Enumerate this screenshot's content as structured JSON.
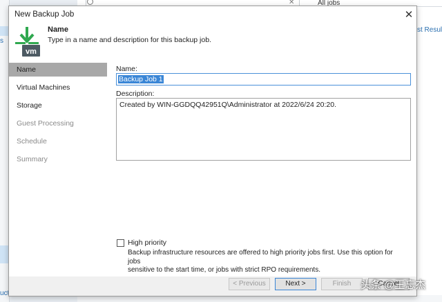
{
  "background": {
    "search_clear": "✕",
    "all_jobs": "All jobs",
    "last_result": "st Result",
    "left_frag_top": "s",
    "left_frag_bottom": "ucti"
  },
  "dialog": {
    "title": "New Backup Job",
    "close": "✕"
  },
  "header": {
    "icon": "vm-icon",
    "title": "Name",
    "description": "Type in a name and description for this backup job."
  },
  "sidebar": {
    "items": [
      {
        "label": "Name",
        "state": "active"
      },
      {
        "label": "Virtual Machines",
        "state": "enabled"
      },
      {
        "label": "Storage",
        "state": "enabled"
      },
      {
        "label": "Guest Processing",
        "state": "disabled"
      },
      {
        "label": "Schedule",
        "state": "disabled"
      },
      {
        "label": "Summary",
        "state": "disabled"
      }
    ]
  },
  "form": {
    "name_label": "Name:",
    "name_value": "Backup Job 1",
    "description_label": "Description:",
    "description_value": "Created by WIN-GGDQQ42951Q\\Administrator at 2022/6/24 20:20.",
    "high_priority_label": "High priority",
    "high_priority_checked": false,
    "high_priority_desc_line1": "Backup infrastructure resources are offered to high priority jobs first. Use this option for jobs",
    "high_priority_desc_line2": "sensitive to the start time, or jobs with strict RPO requirements."
  },
  "footer": {
    "previous": "< Previous",
    "next": "Next >",
    "finish": "Finish",
    "cancel": "Cancel"
  },
  "watermark": "头条 @王忘杰",
  "colors": {
    "accent": "#3a86d6",
    "active_nav": "#a8a8a8",
    "footer_bg": "#f0f0f0",
    "vm_green": "#2fa84f"
  }
}
